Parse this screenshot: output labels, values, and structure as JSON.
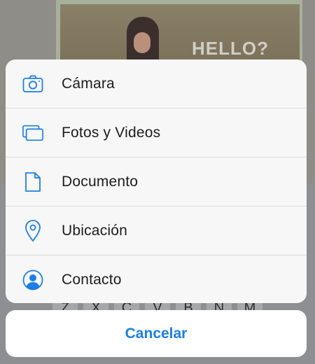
{
  "background": {
    "photo_caption": "HELLO?",
    "keyboard_keys": [
      "Z",
      "X",
      "C",
      "V",
      "B",
      "N",
      "M"
    ]
  },
  "action_sheet": {
    "accent_color": "#1a7fe6",
    "items": [
      {
        "label": "Cámara",
        "icon": "camera-icon"
      },
      {
        "label": "Fotos y Videos",
        "icon": "photos-icon"
      },
      {
        "label": "Documento",
        "icon": "document-icon"
      },
      {
        "label": "Ubicación",
        "icon": "location-icon"
      },
      {
        "label": "Contacto",
        "icon": "contact-icon"
      }
    ],
    "cancel_label": "Cancelar"
  }
}
